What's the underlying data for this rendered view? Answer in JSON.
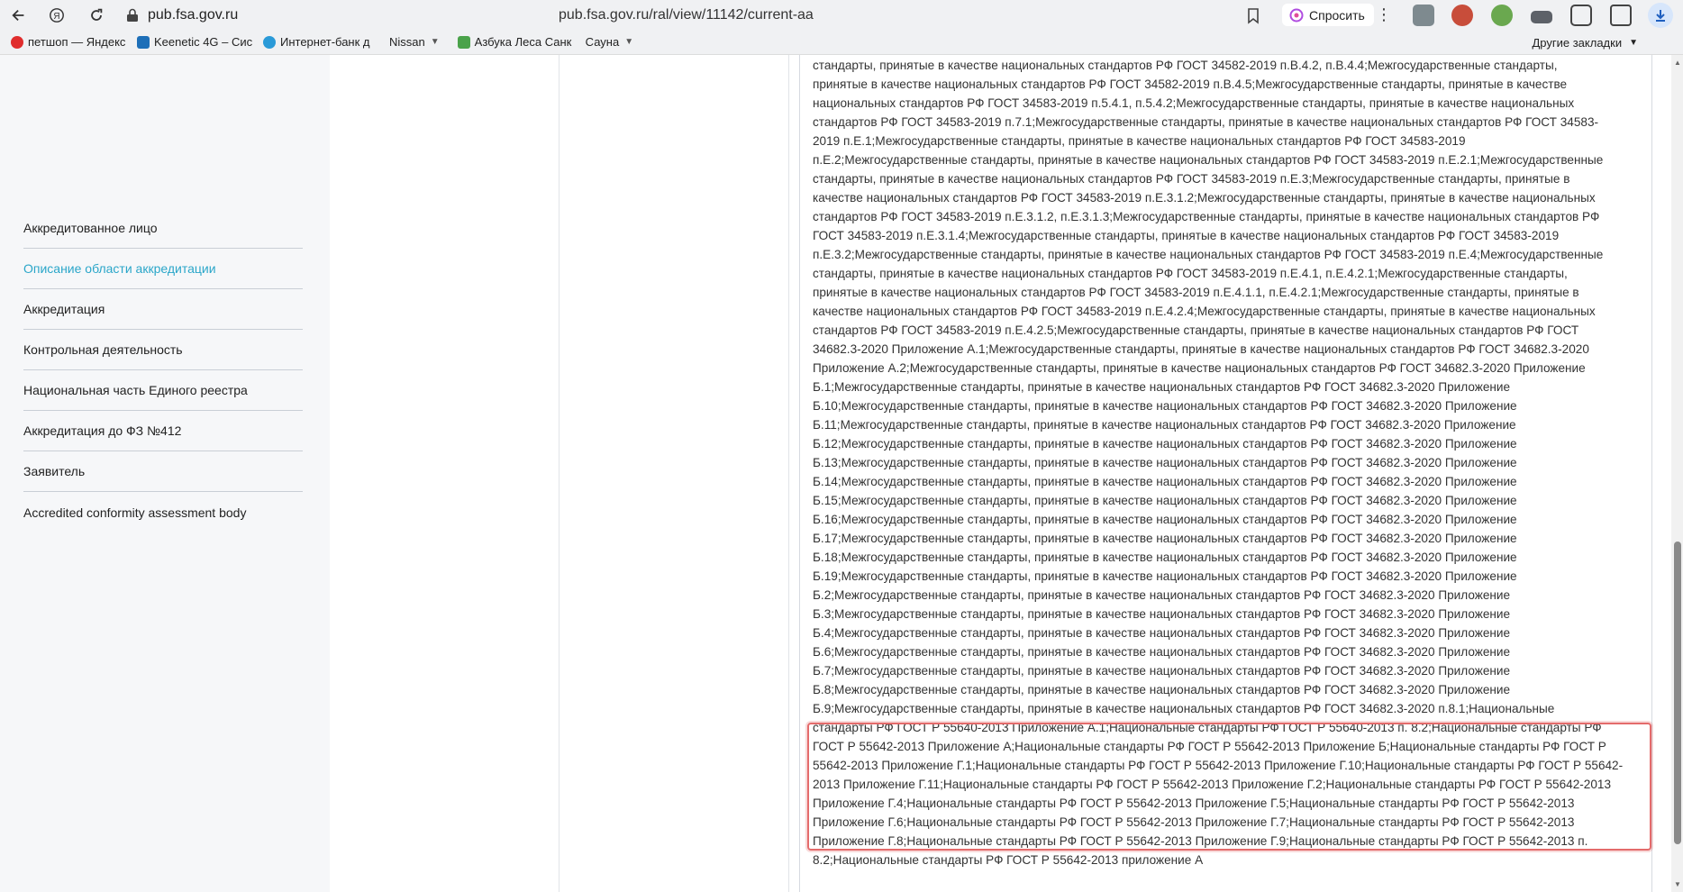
{
  "browser": {
    "host": "pub.fsa.gov.ru",
    "url": "pub.fsa.gov.ru/ral/view/11142/current-aa",
    "ask_label": "Спросить",
    "bookmarks": [
      {
        "label": "петшоп — Яндекс",
        "icon": "yandex-icon",
        "color": "#e02d2d"
      },
      {
        "label": "Keenetic 4G – Сис",
        "icon": "keenetic-icon",
        "color": "#1d6fb8"
      },
      {
        "label": "Интернет-банк д",
        "icon": "bank-icon",
        "color": "#2a9ad8"
      },
      {
        "label": "Nissan",
        "icon": "folder-icon",
        "has_chevron": true
      },
      {
        "label": "Азбука Леса Санк",
        "icon": "tree-icon",
        "color": "#4aa24a"
      },
      {
        "label": "Сауна",
        "icon": "folder-icon",
        "has_chevron": true
      }
    ],
    "other_bookmarks": "Другие закладки"
  },
  "sidebar": {
    "items": [
      {
        "label": "Аккредитованное лицо",
        "active": false
      },
      {
        "label": "Описание области аккредитации",
        "active": true
      },
      {
        "label": "Аккредитация",
        "active": false
      },
      {
        "label": "Контрольная деятельность",
        "active": false
      },
      {
        "label": "Национальная часть Единого реестра",
        "active": false
      },
      {
        "label": "Аккредитация до ФЗ №412",
        "active": false
      },
      {
        "label": "Заявитель",
        "active": false
      },
      {
        "label": "Accredited conformity assessment body",
        "active": false
      }
    ]
  },
  "content": {
    "lines": [
      "стандарты, принятые в качестве национальных стандартов РФ ГОСТ 34582-2019 п.В.4.2, п.В.4.4;Межгосударственные стандарты,",
      "принятые в качестве национальных стандартов РФ ГОСТ 34582-2019 п.В.4.5;Межгосударственные стандарты, принятые в качестве",
      "национальных стандартов РФ ГОСТ 34583-2019 п.5.4.1, п.5.4.2;Межгосударственные стандарты, принятые в качестве национальных",
      "стандартов РФ ГОСТ 34583-2019 п.7.1;Межгосударственные стандарты, принятые в качестве национальных стандартов РФ ГОСТ 34583-",
      "2019 п.Е.1;Межгосударственные стандарты, принятые в качестве национальных стандартов РФ ГОСТ 34583-2019",
      "п.Е.2;Межгосударственные стандарты, принятые в качестве национальных стандартов РФ ГОСТ 34583-2019 п.Е.2.1;Межгосударственные",
      "стандарты, принятые в качестве национальных стандартов РФ ГОСТ 34583-2019 п.Е.3;Межгосударственные стандарты, принятые в",
      "качестве национальных стандартов РФ ГОСТ 34583-2019 п.Е.3.1.2;Межгосударственные стандарты, принятые в качестве национальных",
      "стандартов РФ ГОСТ 34583-2019 п.Е.3.1.2, п.Е.3.1.3;Межгосударственные стандарты, принятые в качестве национальных стандартов РФ",
      "ГОСТ 34583-2019 п.Е.3.1.4;Межгосударственные стандарты, принятые в качестве национальных стандартов РФ ГОСТ 34583-2019",
      "п.Е.3.2;Межгосударственные стандарты, принятые в качестве национальных стандартов РФ ГОСТ 34583-2019 п.Е.4;Межгосударственные",
      "стандарты, принятые в качестве национальных стандартов РФ ГОСТ 34583-2019 п.Е.4.1, п.Е.4.2.1;Межгосударственные стандарты,",
      "принятые в качестве национальных стандартов РФ ГОСТ 34583-2019 п.Е.4.1.1, п.Е.4.2.1;Межгосударственные стандарты, принятые в",
      "качестве национальных стандартов РФ ГОСТ 34583-2019 п.Е.4.2.4;Межгосударственные стандарты, принятые в качестве национальных",
      "стандартов РФ ГОСТ 34583-2019 п.Е.4.2.5;Межгосударственные стандарты, принятые в качестве национальных стандартов РФ ГОСТ",
      "34682.3-2020 Приложение А.1;Межгосударственные стандарты, принятые в качестве национальных стандартов РФ ГОСТ 34682.3-2020",
      "Приложение А.2;Межгосударственные стандарты, принятые в качестве национальных стандартов РФ ГОСТ 34682.3-2020 Приложение",
      "Б.1;Межгосударственные стандарты, принятые в качестве национальных стандартов РФ ГОСТ 34682.3-2020 Приложение",
      "Б.10;Межгосударственные стандарты, принятые в качестве национальных стандартов РФ ГОСТ 34682.3-2020 Приложение",
      "Б.11;Межгосударственные стандарты, принятые в качестве национальных стандартов РФ ГОСТ 34682.3-2020 Приложение",
      "Б.12;Межгосударственные стандарты, принятые в качестве национальных стандартов РФ ГОСТ 34682.3-2020 Приложение",
      "Б.13;Межгосударственные стандарты, принятые в качестве национальных стандартов РФ ГОСТ 34682.3-2020 Приложение",
      "Б.14;Межгосударственные стандарты, принятые в качестве национальных стандартов РФ ГОСТ 34682.3-2020 Приложение",
      "Б.15;Межгосударственные стандарты, принятые в качестве национальных стандартов РФ ГОСТ 34682.3-2020 Приложение",
      "Б.16;Межгосударственные стандарты, принятые в качестве национальных стандартов РФ ГОСТ 34682.3-2020 Приложение",
      "Б.17;Межгосударственные стандарты, принятые в качестве национальных стандартов РФ ГОСТ 34682.3-2020 Приложение",
      "Б.18;Межгосударственные стандарты, принятые в качестве национальных стандартов РФ ГОСТ 34682.3-2020 Приложение",
      "Б.19;Межгосударственные стандарты, принятые в качестве национальных стандартов РФ ГОСТ 34682.3-2020 Приложение",
      "Б.2;Межгосударственные стандарты, принятые в качестве национальных стандартов РФ ГОСТ 34682.3-2020 Приложение",
      "Б.3;Межгосударственные стандарты, принятые в качестве национальных стандартов РФ ГОСТ 34682.3-2020 Приложение",
      "Б.4;Межгосударственные стандарты, принятые в качестве национальных стандартов РФ ГОСТ 34682.3-2020 Приложение",
      "Б.6;Межгосударственные стандарты, принятые в качестве национальных стандартов РФ ГОСТ 34682.3-2020 Приложение",
      "Б.7;Межгосударственные стандарты, принятые в качестве национальных стандартов РФ ГОСТ 34682.3-2020 Приложение",
      "Б.8;Межгосударственные стандарты, принятые в качестве национальных стандартов РФ ГОСТ 34682.3-2020 Приложение",
      "Б.9;Межгосударственные стандарты, принятые в качестве национальных стандартов РФ ГОСТ 34682.3-2020 п.8.1;Национальные",
      "стандарты РФ ГОСТ Р 55640-2013 Приложение А.1;Национальные стандарты РФ ГОСТ Р 55640-2013 п. 8.2;Национальные стандарты РФ",
      "ГОСТ Р 55642-2013 Приложение А;Национальные стандарты РФ ГОСТ Р 55642-2013 Приложение Б;Национальные стандарты РФ ГОСТ Р",
      "55642-2013 Приложение Г.1;Национальные стандарты РФ ГОСТ Р 55642-2013 Приложение Г.10;Национальные стандарты РФ ГОСТ Р 55642-",
      "2013 Приложение Г.11;Национальные стандарты РФ ГОСТ Р 55642-2013 Приложение Г.2;Национальные стандарты РФ ГОСТ Р 55642-2013",
      "Приложение Г.4;Национальные стандарты РФ ГОСТ Р 55642-2013 Приложение Г.5;Национальные стандарты РФ ГОСТ Р 55642-2013",
      "Приложение Г.6;Национальные стандарты РФ ГОСТ Р 55642-2013 Приложение Г.7;Национальные стандарты РФ ГОСТ Р 55642-2013",
      "Приложение Г.8;Национальные стандарты РФ ГОСТ Р 55642-2013 Приложение Г.9;Национальные стандарты РФ ГОСТ Р 55642-2013 п.",
      "8.2;Национальные стандарты РФ ГОСТ Р 55642-2013 приложение А"
    ]
  },
  "colors": {
    "accent": "#2aa6c9",
    "highlight_border": "#e46b6b",
    "sidebar_bg": "#f6f7f9"
  }
}
